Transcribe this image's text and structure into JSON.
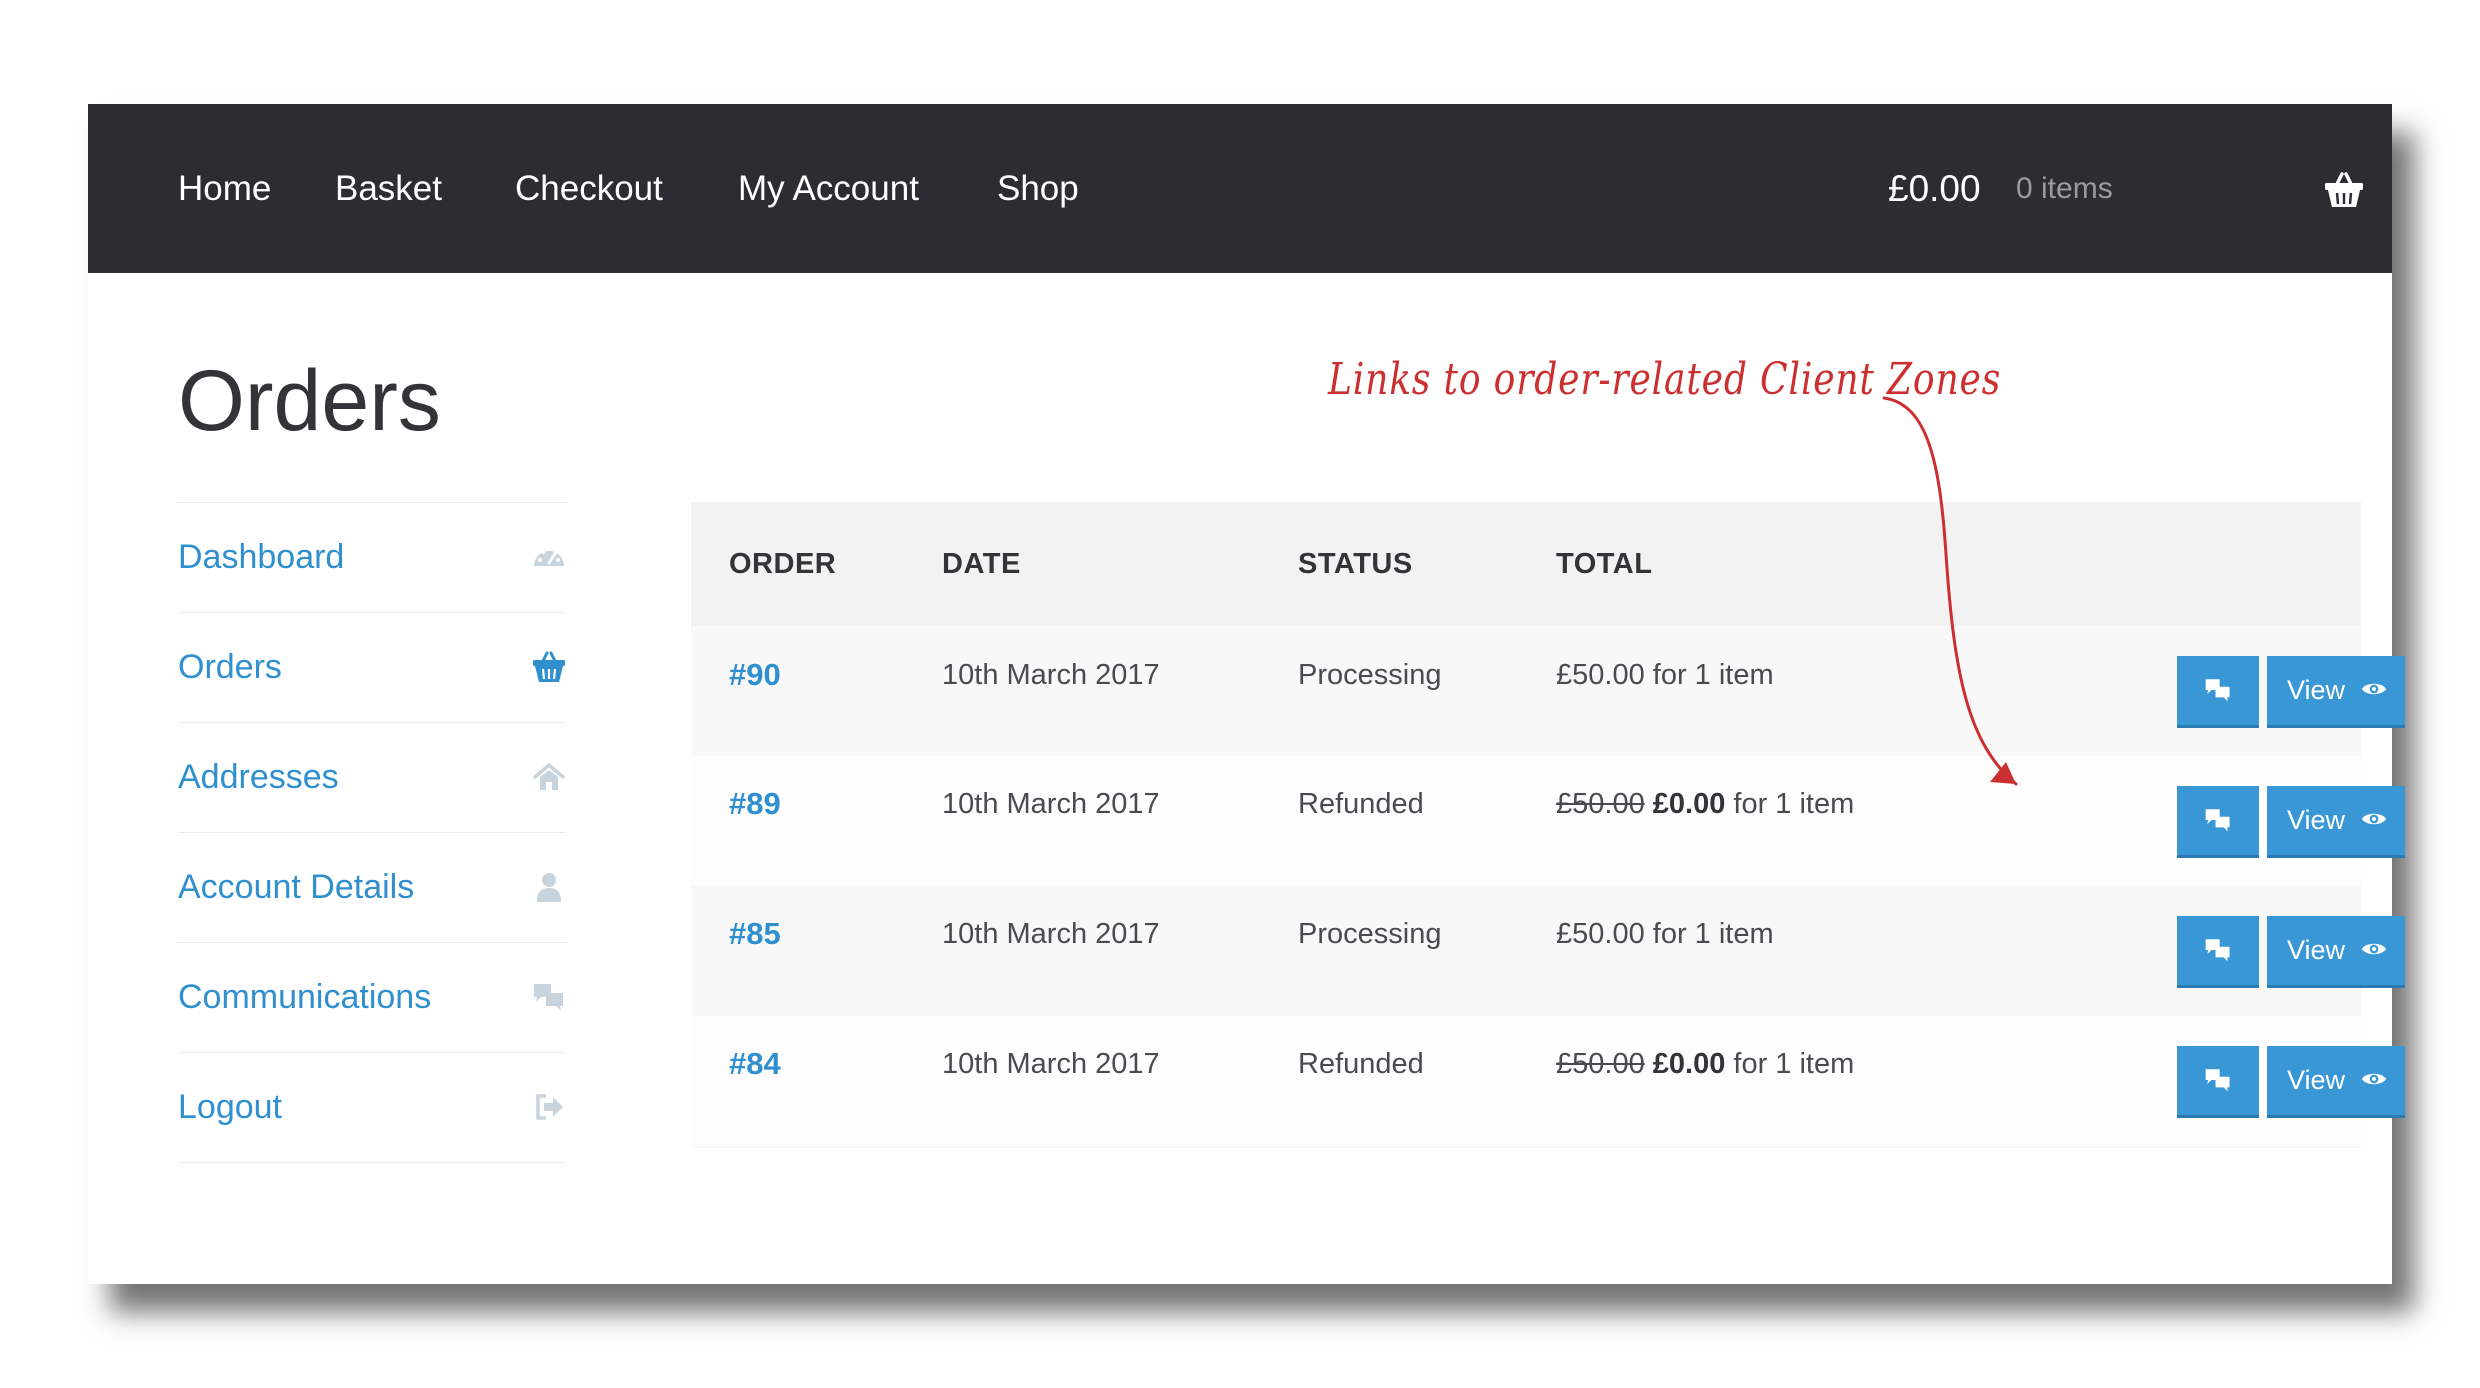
{
  "nav": {
    "items": [
      "Home",
      "Basket",
      "Checkout",
      "My Account",
      "Shop"
    ],
    "cart_total": "£0.00",
    "cart_count": "0 items"
  },
  "page": {
    "title": "Orders"
  },
  "sidebar": {
    "items": [
      {
        "label": "Dashboard",
        "icon": "dashboard-icon"
      },
      {
        "label": "Orders",
        "icon": "basket-icon",
        "active": true
      },
      {
        "label": "Addresses",
        "icon": "home-icon"
      },
      {
        "label": "Account Details",
        "icon": "user-icon"
      },
      {
        "label": "Communications",
        "icon": "comments-icon"
      },
      {
        "label": "Logout",
        "icon": "sign-out-icon"
      }
    ]
  },
  "orders_table": {
    "headers": [
      "ORDER",
      "DATE",
      "STATUS",
      "TOTAL"
    ],
    "rows": [
      {
        "order": "#90",
        "date": "10th March 2017",
        "status": "Processing",
        "old_total": "",
        "total": "£50.00",
        "suffix": " for 1 item",
        "view_label": "View"
      },
      {
        "order": "#89",
        "date": "10th March 2017",
        "status": "Refunded",
        "old_total": "£50.00",
        "total": "£0.00",
        "suffix": " for 1 item",
        "view_label": "View"
      },
      {
        "order": "#85",
        "date": "10th March 2017",
        "status": "Processing",
        "old_total": "",
        "total": "£50.00",
        "suffix": " for 1 item",
        "view_label": "View"
      },
      {
        "order": "#84",
        "date": "10th March 2017",
        "status": "Refunded",
        "old_total": "£50.00",
        "total": "£0.00",
        "suffix": " for 1 item",
        "view_label": "View"
      }
    ]
  },
  "annotation": {
    "text": "Links to order-related Client Zones"
  },
  "colors": {
    "topbar": "#2c2d33",
    "link": "#2f8fcf",
    "button": "#3a97d6",
    "annotation": "#cc2f2f"
  }
}
